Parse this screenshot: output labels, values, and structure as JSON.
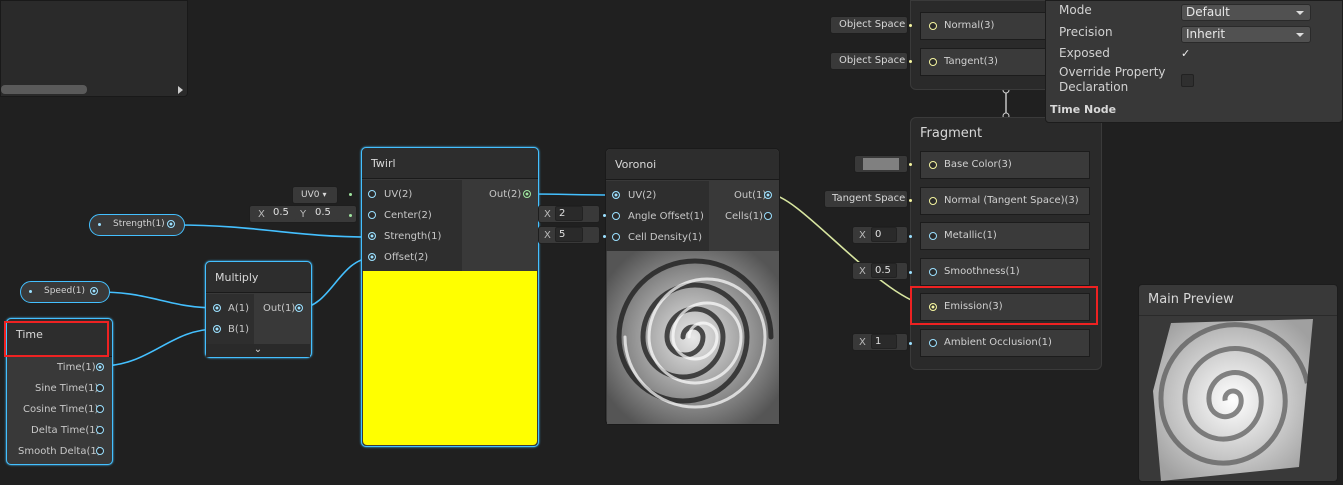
{
  "blackboard": {},
  "vertex": {
    "normal": {
      "label": "Normal(3)",
      "space": "Object Space"
    },
    "tangent": {
      "label": "Tangent(3)",
      "space": "Object Space"
    }
  },
  "inspector": {
    "mode_label": "Mode",
    "mode_value": "Default",
    "precision_label": "Precision",
    "precision_value": "Inherit",
    "exposed_label": "Exposed",
    "override_label": "Override Property Declaration",
    "section_label": "Time Node"
  },
  "fragment": {
    "title": "Fragment",
    "slots": [
      {
        "label": "Base Color(3)"
      },
      {
        "label": "Normal (Tangent Space)(3)",
        "field": "Tangent Space"
      },
      {
        "label": "Metallic(1)",
        "x": "0"
      },
      {
        "label": "Smoothness(1)",
        "x": "0.5"
      },
      {
        "label": "Emission(3)"
      },
      {
        "label": "Ambient Occlusion(1)",
        "x": "1"
      }
    ]
  },
  "twirl": {
    "title": "Twirl",
    "inputs": [
      "UV(2)",
      "Center(2)",
      "Strength(1)",
      "Offset(2)"
    ],
    "output": "Out(2)",
    "uv_field": "UV0",
    "center_x": "0.5",
    "center_y": "0.5",
    "preview_color": "#ffff00"
  },
  "voronoi": {
    "title": "Voronoi",
    "inputs": [
      "UV(2)",
      "Angle Offset(1)",
      "Cell Density(1)"
    ],
    "outputs": [
      "Out(1)",
      "Cells(1)"
    ],
    "angle_offset": "2",
    "cell_density": "5"
  },
  "multiply": {
    "title": "Multiply",
    "inputs": [
      "A(1)",
      "B(1)"
    ],
    "output": "Out(1)"
  },
  "time": {
    "title": "Time",
    "outputs": [
      "Time(1)",
      "Sine Time(1)",
      "Cosine Time(1)",
      "Delta Time(1)",
      "Smooth Delta(1)"
    ]
  },
  "properties": {
    "strength": "Strength(1)",
    "speed": "Speed(1)"
  },
  "preview": {
    "title": "Main Preview"
  },
  "axis": {
    "x": "X",
    "y": "Y"
  }
}
